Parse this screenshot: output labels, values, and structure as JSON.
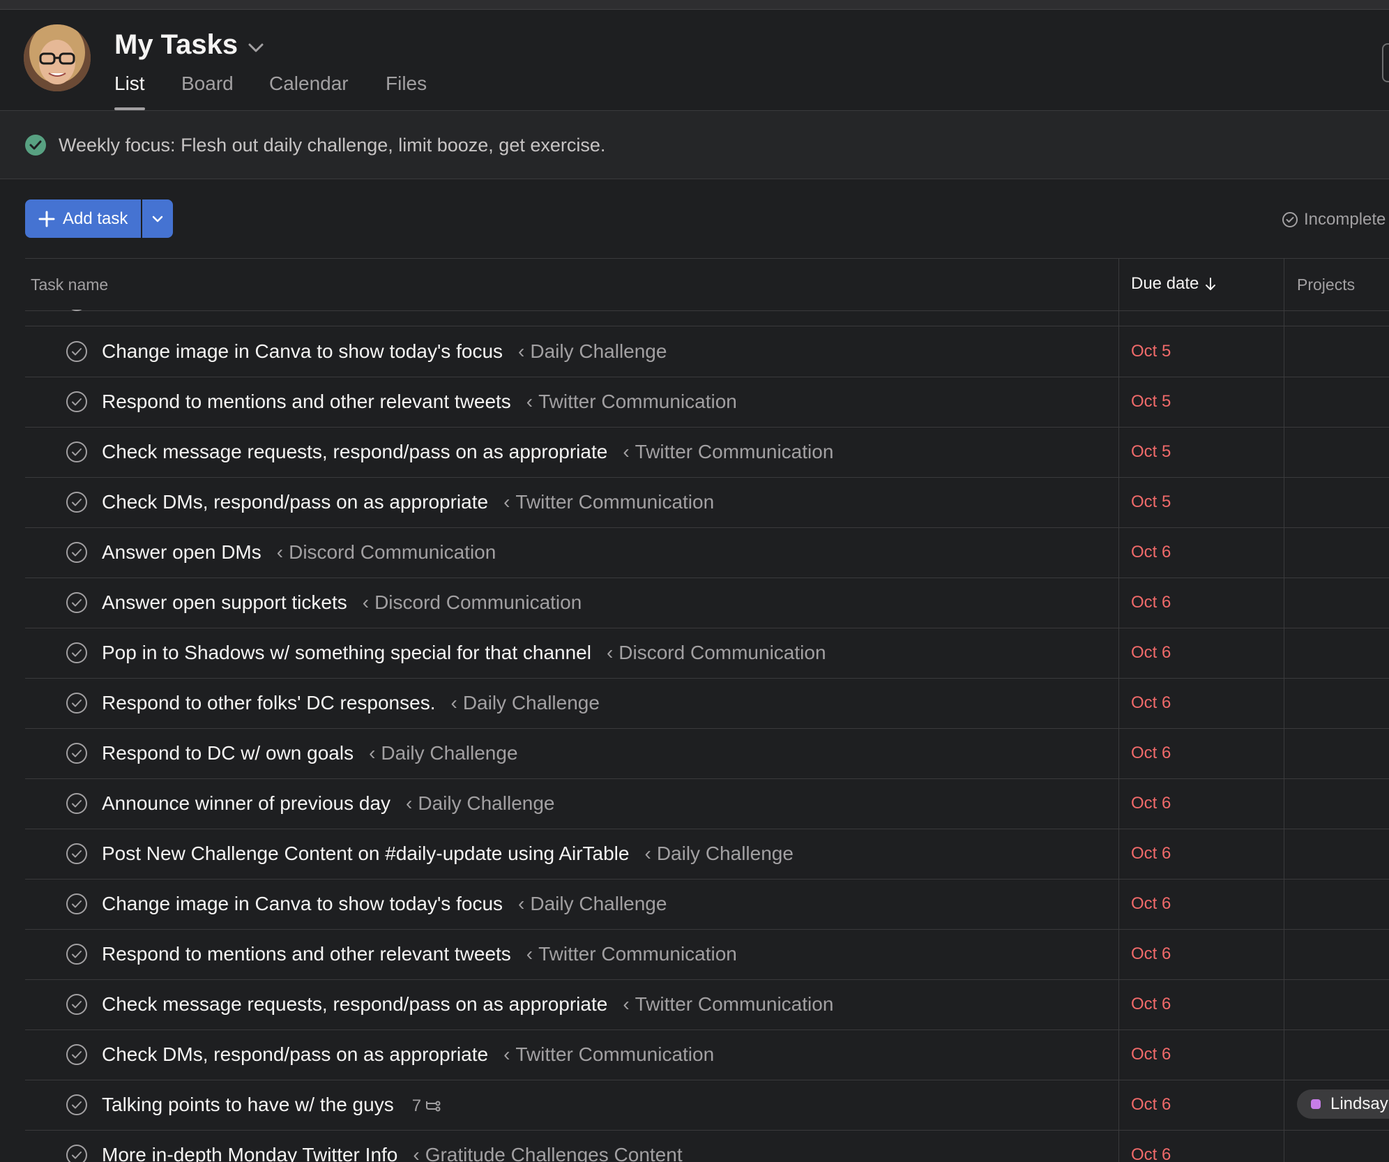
{
  "header": {
    "title": "My Tasks",
    "tabs": [
      {
        "label": "List",
        "active": true
      },
      {
        "label": "Board",
        "active": false
      },
      {
        "label": "Calendar",
        "active": false
      },
      {
        "label": "Files",
        "active": false
      }
    ]
  },
  "focus": {
    "text": "Weekly focus: Flesh out daily challenge, limit booze, get exercise."
  },
  "toolbar": {
    "add_task_label": "Add task",
    "filter_label": "Incomplete"
  },
  "table": {
    "columns": {
      "task_name": "Task name",
      "due_date": "Due date",
      "projects": "Projects"
    },
    "rows": [
      {
        "name": "Change image in Canva to show today's focus",
        "parent": "Daily Challenge",
        "due": "Oct 5"
      },
      {
        "name": "Respond to mentions and other relevant tweets",
        "parent": "Twitter Communication",
        "due": "Oct 5"
      },
      {
        "name": "Check message requests, respond/pass on as appropriate",
        "parent": "Twitter Communication",
        "due": "Oct 5"
      },
      {
        "name": "Check DMs, respond/pass on as appropriate",
        "parent": "Twitter Communication",
        "due": "Oct 5"
      },
      {
        "name": "Answer open DMs",
        "parent": "Discord Communication",
        "due": "Oct 6"
      },
      {
        "name": "Answer open support tickets",
        "parent": "Discord Communication",
        "due": "Oct 6"
      },
      {
        "name": "Pop in to Shadows w/ something special for that channel",
        "parent": "Discord Communication",
        "due": "Oct 6"
      },
      {
        "name": "Respond to other folks' DC responses.",
        "parent": "Daily Challenge",
        "due": "Oct 6"
      },
      {
        "name": "Respond to DC w/ own goals",
        "parent": "Daily Challenge",
        "due": "Oct 6"
      },
      {
        "name": "Announce winner of previous day",
        "parent": "Daily Challenge",
        "due": "Oct 6"
      },
      {
        "name": "Post New Challenge Content on #daily-update using AirTable",
        "parent": "Daily Challenge",
        "due": "Oct 6"
      },
      {
        "name": "Change image in Canva to show today's focus",
        "parent": "Daily Challenge",
        "due": "Oct 6"
      },
      {
        "name": "Respond to mentions and other relevant tweets",
        "parent": "Twitter Communication",
        "due": "Oct 6"
      },
      {
        "name": "Check message requests, respond/pass on as appropriate",
        "parent": "Twitter Communication",
        "due": "Oct 6"
      },
      {
        "name": "Check DMs, respond/pass on as appropriate",
        "parent": "Twitter Communication",
        "due": "Oct 6"
      },
      {
        "name": "Talking points to have w/ the guys",
        "subtasks": "7",
        "due": "Oct 6",
        "project": "Lindsay"
      },
      {
        "name": "More in-depth Monday Twitter Info",
        "parent": "Gratitude Challenges Content",
        "due": "Oct 6"
      }
    ]
  },
  "colors": {
    "accent": "#4573d2",
    "overdue": "#f06a6a",
    "success": "#58a182",
    "project_dot": "#c77de8"
  },
  "icons": {
    "avatar": "user-avatar",
    "check": "check-circle-icon",
    "subtasks": "subtask-icon"
  }
}
